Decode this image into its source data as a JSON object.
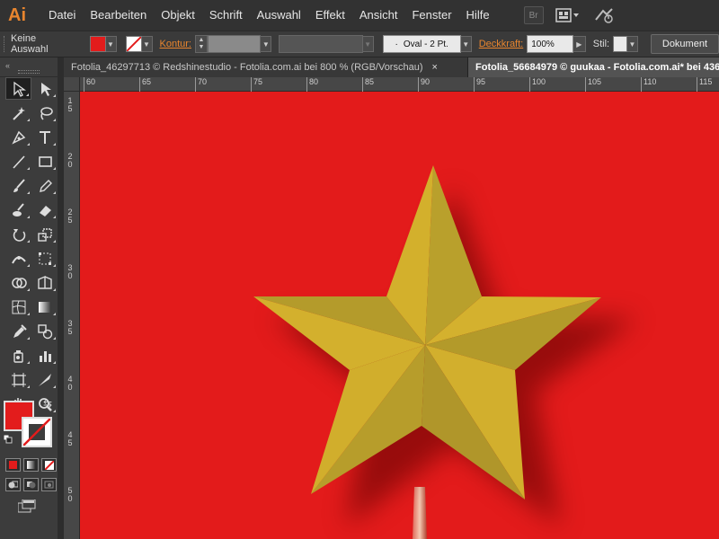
{
  "app": {
    "logo": "Ai"
  },
  "menu": [
    "Datei",
    "Bearbeiten",
    "Objekt",
    "Schrift",
    "Auswahl",
    "Effekt",
    "Ansicht",
    "Fenster",
    "Hilfe"
  ],
  "menubar_buttons": {
    "bridge": "Br",
    "arrange_icon": "arrange-documents-icon",
    "sync_icon": "sync-settings-icon"
  },
  "control": {
    "selection": "Keine Auswahl",
    "kontur_label": "Kontur:",
    "brush": "Oval - 2 Pt.",
    "opacity_label": "Deckkraft:",
    "opacity_value": "100%",
    "style_label": "Stil:",
    "document_button": "Dokument"
  },
  "tabs": [
    {
      "title": "Fotolia_46297713 © Redshinestudio - Fotolia.com.ai bei 800 % (RGB/Vorschau)",
      "active": false,
      "close": "×"
    },
    {
      "title": "Fotolia_56684979 © guukaa - Fotolia.com.ai* bei 436",
      "active": true
    }
  ],
  "ruler": {
    "top": [
      "60",
      "65",
      "70",
      "75",
      "80",
      "85",
      "90",
      "95",
      "100",
      "105",
      "110",
      "115"
    ],
    "left": [
      "1\n5",
      "2\n0",
      "2\n5",
      "3\n0",
      "3\n5",
      "4\n0",
      "4\n5",
      "5\n0"
    ]
  },
  "colors": {
    "fill": "#e31c1c",
    "canvas": "#e31b1b",
    "star_light": "#d4b12c",
    "star_dark": "#b0962a",
    "accent": "#e8852e"
  },
  "tools": [
    [
      "selection-tool",
      "direct-selection-tool"
    ],
    [
      "magic-wand-tool",
      "lasso-tool"
    ],
    [
      "pen-tool",
      "type-tool"
    ],
    [
      "line-tool",
      "rectangle-tool"
    ],
    [
      "paintbrush-tool",
      "pencil-tool"
    ],
    [
      "blob-brush-tool",
      "eraser-tool"
    ],
    [
      "rotate-tool",
      "scale-tool"
    ],
    [
      "width-tool",
      "free-transform-tool"
    ],
    [
      "shape-builder-tool",
      "perspective-grid-tool"
    ],
    [
      "mesh-tool",
      "gradient-tool"
    ],
    [
      "eyedropper-tool",
      "blend-tool"
    ],
    [
      "symbol-sprayer-tool",
      "column-graph-tool"
    ],
    [
      "artboard-tool",
      "slice-tool"
    ],
    [
      "hand-tool",
      "zoom-tool"
    ]
  ]
}
